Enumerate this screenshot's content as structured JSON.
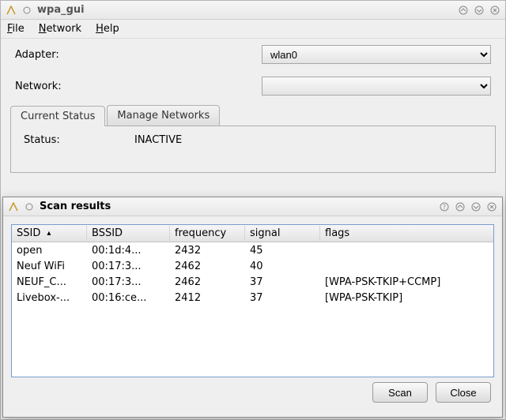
{
  "main": {
    "title": "wpa_gui",
    "menu": {
      "file": "File",
      "network": "Network",
      "help": "Help"
    },
    "adapter_label": "Adapter:",
    "adapter_value": "wlan0",
    "network_label": "Network:",
    "network_value": "",
    "tabs": {
      "current": "Current Status",
      "manage": "Manage Networks"
    },
    "status_label": "Status:",
    "status_value": "INACTIVE"
  },
  "scan": {
    "title": "Scan results",
    "headers": {
      "ssid": "SSID",
      "bssid": "BSSID",
      "freq": "frequency",
      "signal": "signal",
      "flags": "flags"
    },
    "rows": [
      {
        "ssid": "open",
        "bssid": "00:1d:4...",
        "freq": "2432",
        "signal": "45",
        "flags": ""
      },
      {
        "ssid": "Neuf WiFi",
        "bssid": "00:17:3...",
        "freq": "2462",
        "signal": "40",
        "flags": ""
      },
      {
        "ssid": "NEUF_C...",
        "bssid": "00:17:3...",
        "freq": "2462",
        "signal": "37",
        "flags": "[WPA-PSK-TKIP+CCMP]"
      },
      {
        "ssid": "Livebox-...",
        "bssid": "00:16:ce...",
        "freq": "2412",
        "signal": "37",
        "flags": "[WPA-PSK-TKIP]"
      }
    ],
    "buttons": {
      "scan": "Scan",
      "close": "Close"
    }
  }
}
